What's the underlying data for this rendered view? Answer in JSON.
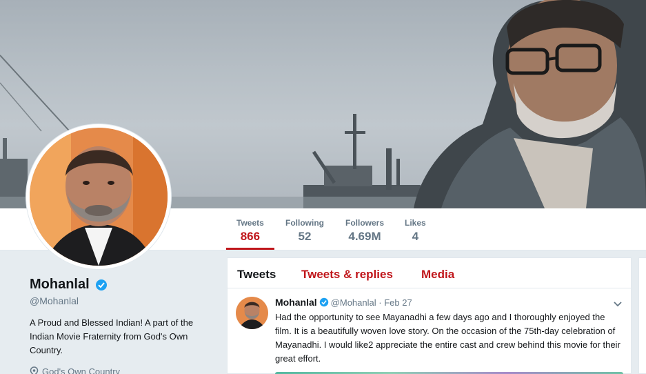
{
  "stats": [
    {
      "label": "Tweets",
      "value": "866"
    },
    {
      "label": "Following",
      "value": "52"
    },
    {
      "label": "Followers",
      "value": "4.69M"
    },
    {
      "label": "Likes",
      "value": "4"
    }
  ],
  "profile": {
    "name": "Mohanlal",
    "handle": "@Mohanlal",
    "bio": "A Proud and Blessed Indian! A part of the Indian Movie Fraternity from God's Own Country.",
    "location": "God's Own Country"
  },
  "timeline": {
    "tabs": [
      "Tweets",
      "Tweets & replies",
      "Media"
    ],
    "tweet": {
      "name": "Mohanlal",
      "handle": "@Mohanlal",
      "separator": "·",
      "time": "Feb 27",
      "text": "Had the opportunity to see Mayanadhi a few days ago and I thoroughly enjoyed the film. It is a beautifully woven love story. On the occasion of the 75th-day celebration of Mayanadhi. I would like2 appreciate the entire cast and crew behind this movie for their great effort."
    }
  },
  "colors": {
    "accent": "#c0161b",
    "verified": "#1da1f2",
    "muted": "#657786"
  }
}
